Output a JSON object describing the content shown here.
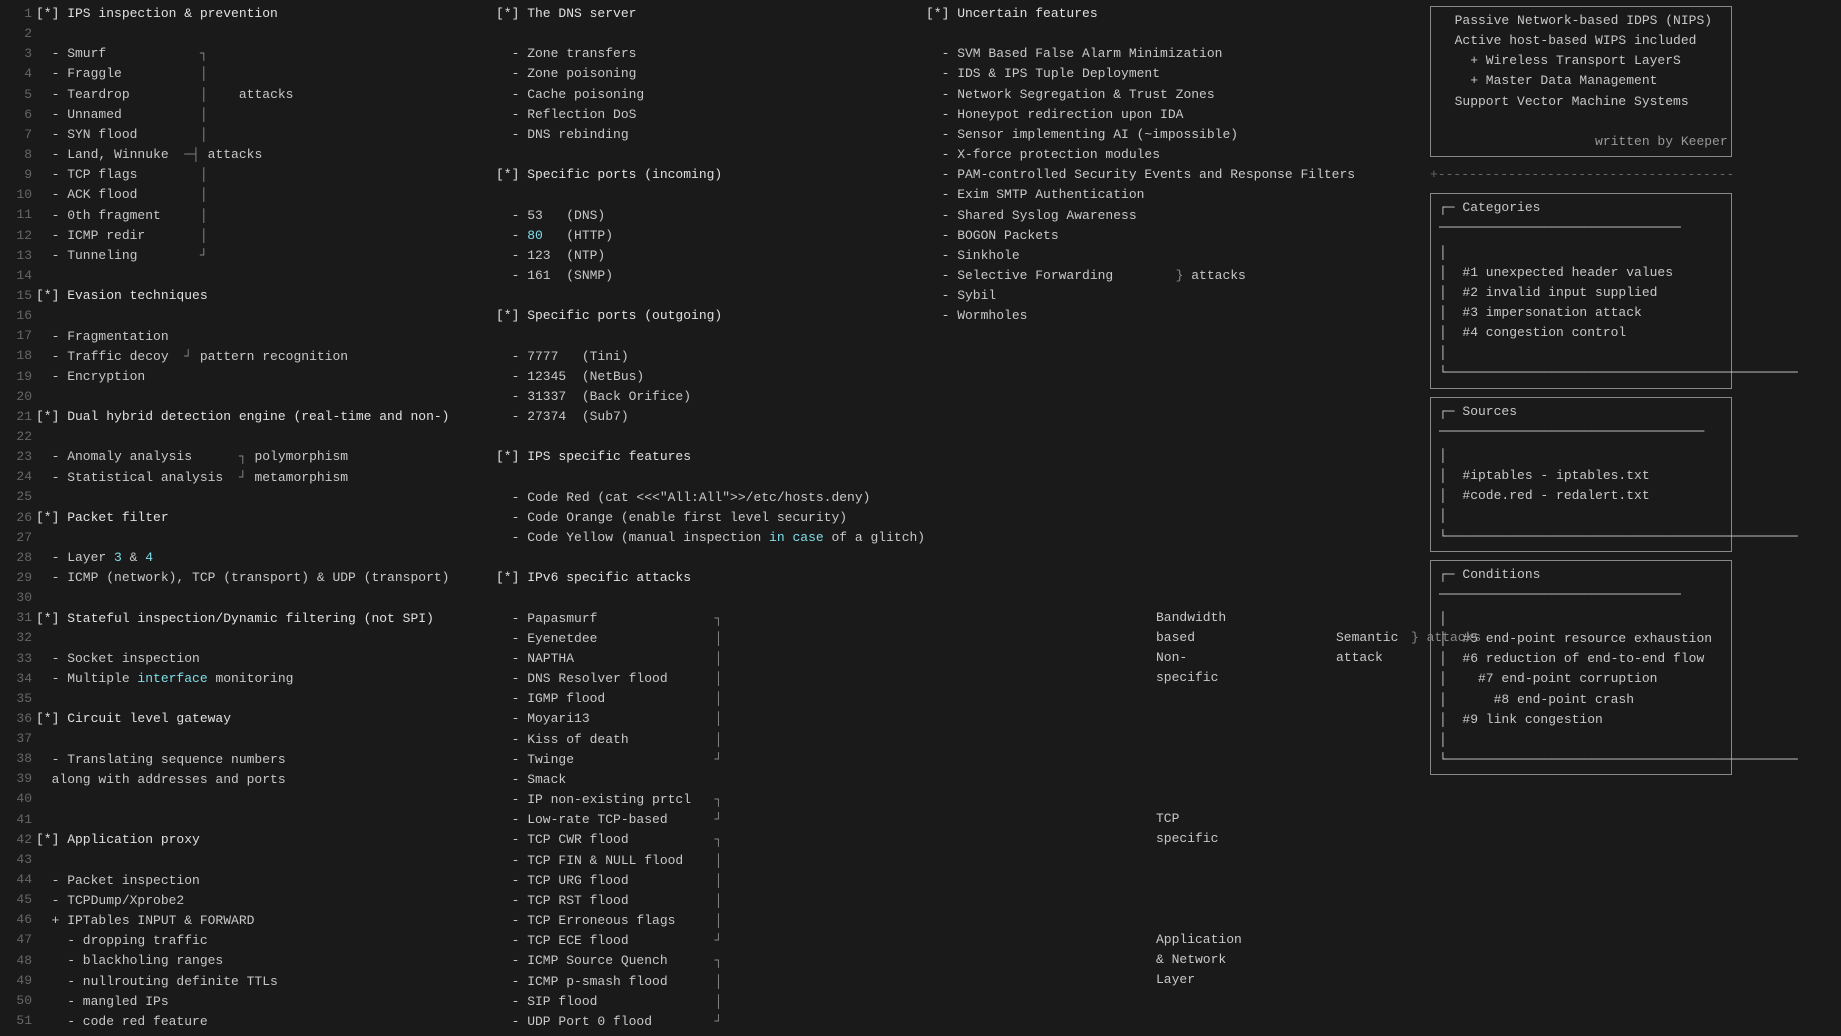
{
  "page": {
    "bg": "#1a1a1a",
    "fg": "#c8c8c8"
  },
  "line_numbers": [
    1,
    2,
    3,
    4,
    5,
    6,
    7,
    8,
    9,
    10,
    11,
    12,
    13,
    14,
    15,
    16,
    17,
    18,
    19,
    20,
    21,
    22,
    23,
    24,
    25,
    26,
    27,
    28,
    29,
    30,
    31,
    32,
    33,
    34,
    35,
    36,
    37,
    38,
    39,
    40,
    41,
    42,
    43,
    44,
    45,
    46,
    47,
    48,
    49,
    50,
    51
  ],
  "col1": {
    "lines": [
      "[*] IPS inspection & prevention",
      "",
      "  - Smurf",
      "  - Fraggle",
      "  - Teardrop                           attacks",
      "  - Unnamed",
      "  - SYN flood",
      "  - Land, Winnuke  ┤ attacks",
      "  - TCP flags",
      "  - ACK flood",
      "  - 0th fragment",
      "  - ICMP redir",
      "  - Tunneling",
      "",
      "[*] Evasion techniques",
      "",
      "  - Fragmentation",
      "  - Traffic decoy  ┘ pattern recognition",
      "  - Encryption",
      "",
      "[*] Dual hybrid detection engine (real-time and non-)",
      "",
      "  - Anomaly analysis      ┐ polymorphism",
      "  - Statistical analysis  ┘ metamorphism",
      "",
      "[*] Packet filter",
      "",
      "  - Layer 3 & 4",
      "  - ICMP (network), TCP (transport) & UDP (transport)",
      "",
      "[*] Stateful inspection/Dynamic filtering (not SPI)",
      "",
      "  - Socket inspection",
      "  - Multiple interface monitoring",
      "",
      "[*] Circuit level gateway",
      "",
      "  - Translating sequence numbers",
      "  along with addresses and ports",
      "",
      "",
      "[*] Application proxy",
      "",
      "  - Packet inspection",
      "  - TCPDump/Xprobe2",
      "  + IPTables INPUT & FORWARD",
      "    - dropping traffic",
      "    - blackholing ranges",
      "    - nullrouting definite TTLs",
      "    - mangled IPs",
      "    - code red feature"
    ]
  },
  "col2": {
    "lines": [
      "[*] The DNS server",
      "",
      "  - Zone transfers",
      "  - Zone poisoning",
      "  - Cache poisoning",
      "  - Reflection DoS",
      "  - DNS rebinding",
      "",
      "[*] Specific ports (incoming)",
      "",
      "  - 53   (DNS)",
      "  - 80   (HTTP)",
      "  - 123  (NTP)",
      "  - 161  (SNMP)",
      "",
      "[*] Specific ports (outgoing)",
      "",
      "  - 7777   (Tini)",
      "  - 12345  (NetBus)",
      "  - 31337  (Back Orifice)",
      "  - 27374  (Sub7)",
      "",
      "[*] IPS specific features",
      "",
      "  - Code Red (cat <<<\"All:All\">>/etc/hosts.deny)",
      "  - Code Orange (enable first level security)",
      "  - Code Yellow (manual inspection in case of a glitch)",
      "",
      "[*] IPv6 specific attacks",
      "",
      "  - Papasmurf",
      "  - Eyenetdee",
      "  - NAPTHA",
      "  - DNS Resolver flood",
      "  - IGMP flood",
      "  - Moyari13",
      "  - Kiss of death",
      "  - Twinge",
      "  - Smack",
      "  - IP non-existing prtcl",
      "  - Low-rate TCP-based",
      "  - TCP CWR flood",
      "  - TCP FIN & NULL flood",
      "  - TCP URG flood",
      "  - TCP RST flood",
      "  - TCP Erroneous flags",
      "  - TCP ECE flood",
      "  - ICMP Source Quench",
      "  - ICMP p-smash flood",
      "  - SIP flood",
      "  - UDP Port 0 flood"
    ]
  },
  "col3": {
    "lines": [
      "[*] Uncertain features",
      "",
      "  - SVM Based False Alarm Minimization",
      "  - IDS & IPS Tuple Deployment",
      "  - Network Segregation & Trust Zones",
      "  - Honeypot redirection upon IDA",
      "  - Sensor implementing AI (~impossible)",
      "  - X-force protection modules",
      "  - PAM-controlled Security Events and Response Filters",
      "  - Exim SMTP Authentication",
      "  - Shared Syslog Awareness",
      "  - BOGON Packets",
      "  - Sinkhole",
      "  - Selective Forwarding   } attacks",
      "  - Sybil",
      "  - Wormholes",
      "",
      "",
      "",
      "",
      "",
      "",
      "",
      "",
      "",
      "",
      "",
      "",
      "",
      "",
      "",
      "  Bandwidth",
      "  based",
      "",
      "  Non-",
      "  specific",
      "",
      "",
      "",
      "",
      "",
      "",
      "  TCP",
      "  specific",
      "",
      "",
      "",
      "",
      "",
      "  Application",
      "  & Network",
      "  Layer",
      ""
    ]
  },
  "col4_top": [
    "+--------------------------------------------+",
    "  Passive Network-based IDPS (NIPS)",
    "  Active host-based WIPS included",
    "    + Wireless Transport LayerS",
    "    + Master Data Management",
    "  Support Vector Machine Systems",
    "",
    "                      written by Keeper",
    "+--------------------------------------------+",
    "",
    "┌─ Categories ──────────────────────────────",
    "│",
    "│  #1 unexpected header values",
    "│  #2 invalid input supplied",
    "│  #3 impersonation attack",
    "│  #4 congestion control",
    "│",
    "└───────────────────────────────────────────",
    "",
    "┌─ Sources ─────────────────────────────────",
    "│",
    "│  #iptables - iptables.txt",
    "│  #code.red - redalert.txt",
    "│",
    "└───────────────────────────────────────────",
    "",
    "┌─ Conditions ──────────────────────────────",
    "│",
    "│  #5 end-point resource exhaustion",
    "│  #6 reduction of end-to-end flow",
    "│    #7 end-point corruption",
    "│      #8 end-point crash",
    "│  #9 link congestion",
    "│",
    "└───────────────────────────────────────────"
  ],
  "attacks_labels": {
    "col2_attacks": "attacks",
    "col3_attacks": "attacks",
    "semantic": "Semantic\nattack"
  }
}
